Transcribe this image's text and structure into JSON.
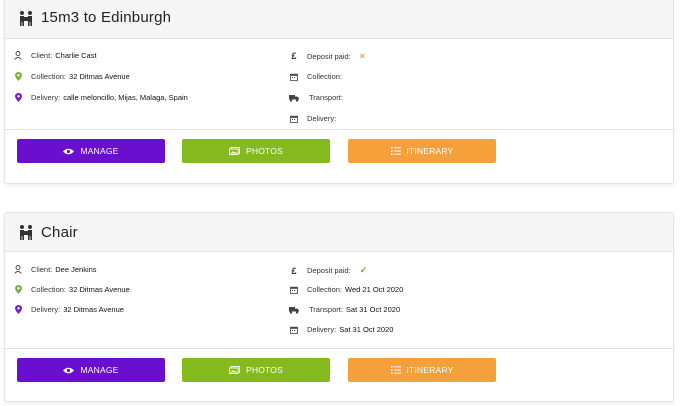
{
  "jobs": [
    {
      "title": "15m3 to Edinburgh",
      "client_label": "Client:",
      "client": "Charlie Cast",
      "collection_label": "Collection:",
      "collection": "32 Ditmas Avenue",
      "delivery_label": "Delivery:",
      "delivery": "calle meloncillo, Mijas, Malaga, Spain",
      "deposit_label": "Deposit paid:",
      "deposit_status": "×",
      "collection_date_label": "Collection:",
      "collection_date": "",
      "transport_label": "Transport:",
      "transport_date": "",
      "delivery_date_label": "Delivery:",
      "delivery_date": "",
      "buttons": {
        "manage": "MANAGE",
        "photos": "PHOTOS",
        "itinerary": "ITINERARY"
      }
    },
    {
      "title": "Chair",
      "client_label": "Client:",
      "client": "Dee Jenkins",
      "collection_label": "Collection:",
      "collection": "32 Ditmas Avenue",
      "delivery_label": "Delivery:",
      "delivery": "32 Ditmas Avenue",
      "deposit_label": "Deposit paid:",
      "deposit_status": "✓",
      "collection_date_label": "Collection:",
      "collection_date": "Wed 21 Oct 2020",
      "transport_label": "Transport:",
      "transport_date": "Sat 31 Oct 2020",
      "delivery_date_label": "Delivery:",
      "delivery_date": "Sat 31 Oct 2020",
      "buttons": {
        "manage": "MANAGE",
        "photos": "PHOTOS",
        "itinerary": "ITINERARY"
      }
    }
  ],
  "colors": {
    "manage": "#6a0fd0",
    "photos": "#85ba1f",
    "itinerary": "#f5a03b",
    "collection_pin": "#7cb342",
    "delivery_pin": "#7b1fd0",
    "deposit_unpaid": "#f29a38",
    "deposit_paid": "#6cae1f"
  },
  "icons": {
    "title": "movers-icon",
    "client": "user-icon",
    "collection": "map-pin-icon",
    "delivery": "map-pin-icon",
    "deposit": "pound-icon",
    "calendar": "calendar-icon",
    "transport": "truck-icon",
    "manage": "eye-icon",
    "photos": "images-icon",
    "itinerary": "list-icon"
  }
}
